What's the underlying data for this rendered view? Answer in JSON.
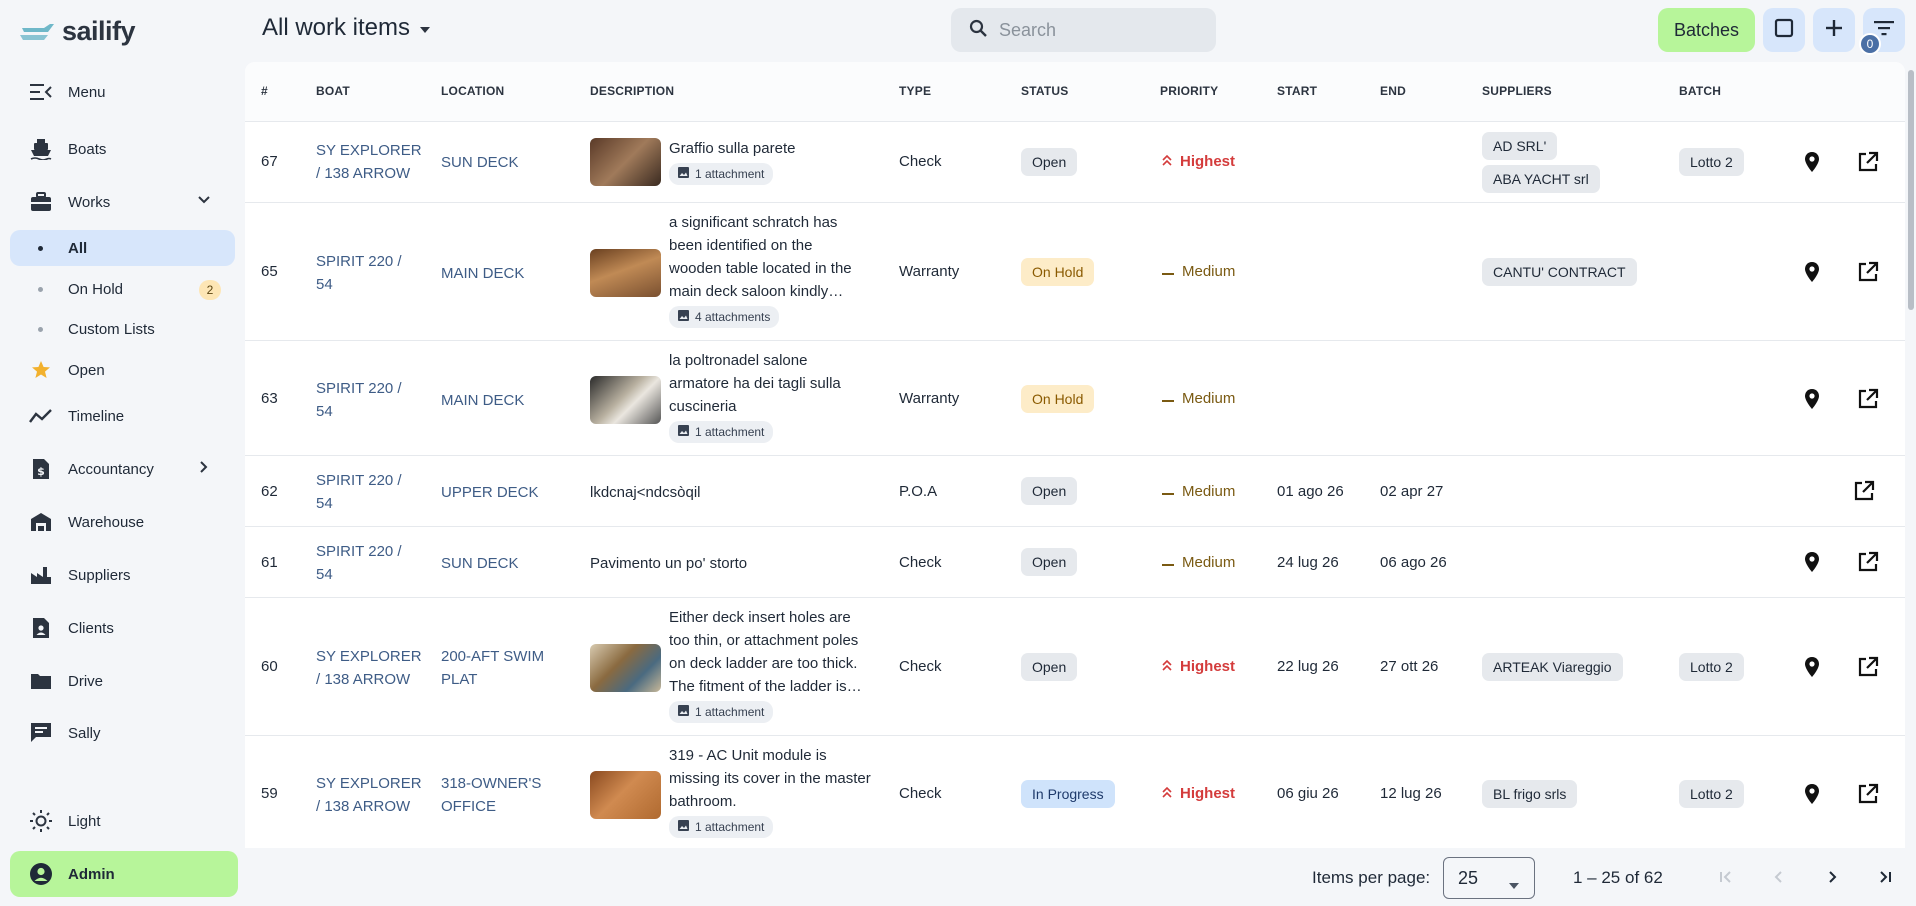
{
  "app": {
    "logo_text": "sailify"
  },
  "sidebar": {
    "items": [
      {
        "label": "Menu",
        "icon": "menu-open-icon"
      },
      {
        "label": "Boats",
        "icon": "ferry-icon"
      },
      {
        "label": "Works",
        "icon": "toolbox-icon",
        "expanded": true
      },
      {
        "label": "Open",
        "icon": "star-icon"
      },
      {
        "label": "Timeline",
        "icon": "timeline-icon"
      },
      {
        "label": "Accountancy",
        "icon": "invoice-dollar-icon"
      },
      {
        "label": "Warehouse",
        "icon": "warehouse-icon"
      },
      {
        "label": "Suppliers",
        "icon": "factory-icon"
      },
      {
        "label": "Clients",
        "icon": "contact-card-icon"
      },
      {
        "label": "Drive",
        "icon": "folder-icon"
      },
      {
        "label": "Sally",
        "icon": "chat-icon"
      },
      {
        "label": "Light",
        "icon": "sun-icon"
      },
      {
        "label": "Admin",
        "icon": "account-circle-icon"
      }
    ],
    "works_sub": [
      {
        "label": "All",
        "active": true
      },
      {
        "label": "On Hold",
        "count": "2"
      },
      {
        "label": "Custom Lists"
      }
    ]
  },
  "header": {
    "title": "All work items",
    "search_placeholder": "Search",
    "batches_label": "Batches",
    "filter_count": "0"
  },
  "table": {
    "columns": [
      "#",
      "BOAT",
      "LOCATION",
      "DESCRIPTION",
      "TYPE",
      "STATUS",
      "PRIORITY",
      "START",
      "END",
      "SUPPLIERS",
      "BATCH"
    ],
    "rows": [
      {
        "id": "67",
        "boat": "SY EXPLORER / 138 ARROW",
        "location": "SUN DECK",
        "description": "Graffio sulla parete",
        "attachments": "1 attachment",
        "type": "Check",
        "status": "Open",
        "priority": "Highest",
        "start": "",
        "end": "",
        "suppliers": [
          "AD SRL'",
          "ABA YACHT srl"
        ],
        "batch": "Lotto 2"
      },
      {
        "id": "65",
        "boat": "SPIRIT 220 / 54",
        "location": "MAIN DECK",
        "description": "a significant schratch has been identified on the wooden table located in the main deck saloon kindly…",
        "attachments": "4 attachments",
        "type": "Warranty",
        "status": "On Hold",
        "priority": "Medium",
        "start": "",
        "end": "",
        "suppliers": [
          "CANTU' CONTRACT"
        ],
        "batch": ""
      },
      {
        "id": "63",
        "boat": "SPIRIT 220 / 54",
        "location": "MAIN DECK",
        "description": "la poltronadel salone armatore ha dei tagli sulla cuscineria",
        "attachments": "1 attachment",
        "type": "Warranty",
        "status": "On Hold",
        "priority": "Medium",
        "start": "",
        "end": "",
        "suppliers": [],
        "batch": ""
      },
      {
        "id": "62",
        "boat": "SPIRIT 220 / 54",
        "location": "UPPER DECK",
        "description": "lkdcnaj<ndcsòqil",
        "attachments": "",
        "type": "P.O.A",
        "status": "Open",
        "priority": "Medium",
        "start": "01 ago 26",
        "end": "02 apr 27",
        "suppliers": [],
        "batch": ""
      },
      {
        "id": "61",
        "boat": "SPIRIT 220 / 54",
        "location": "SUN DECK",
        "description": "Pavimento un po' storto",
        "attachments": "",
        "type": "Check",
        "status": "Open",
        "priority": "Medium",
        "start": "24 lug 26",
        "end": "06 ago 26",
        "suppliers": [],
        "batch": ""
      },
      {
        "id": "60",
        "boat": "SY EXPLORER / 138 ARROW",
        "location": "200-AFT SWIM PLAT",
        "description": "Either deck insert holes are too thin, or attachment poles on deck ladder are too thick. The fitment of the ladder is…",
        "attachments": "1 attachment",
        "type": "Check",
        "status": "Open",
        "priority": "Highest",
        "start": "22 lug 26",
        "end": "27 ott 26",
        "suppliers": [
          "ARTEAK Viareggio"
        ],
        "batch": "Lotto 2"
      },
      {
        "id": "59",
        "boat": "SY EXPLORER / 138 ARROW",
        "location": "318-OWNER'S OFFICE",
        "description": "319 - AC Unit module is missing its cover in the master bathroom.",
        "attachments": "1 attachment",
        "type": "Check",
        "status": "In Progress",
        "priority": "Highest",
        "start": "06 giu 26",
        "end": "12 lug 26",
        "suppliers": [
          "BL frigo srls"
        ],
        "batch": "Lotto 2"
      }
    ]
  },
  "footer": {
    "items_per_page_label": "Items per page:",
    "items_per_page_value": "25",
    "range": "1 – 25 of 62"
  }
}
